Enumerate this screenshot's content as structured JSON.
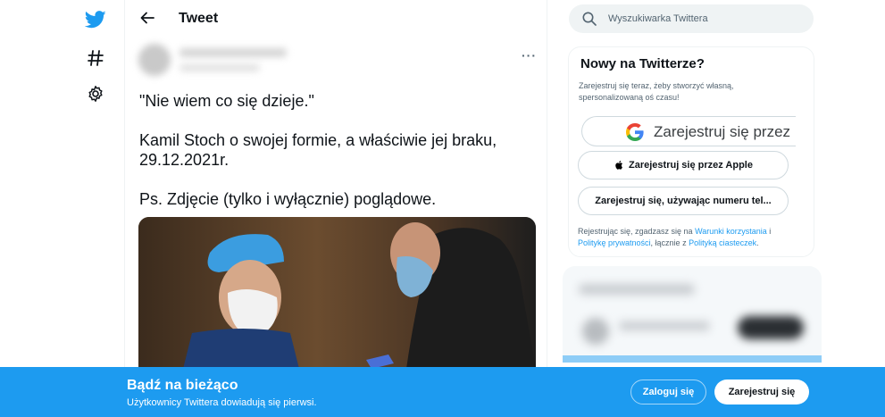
{
  "nav": {
    "items": [
      {
        "icon": "twitter-bird-icon",
        "color": "#1d9bf0"
      },
      {
        "icon": "hashtag-icon"
      },
      {
        "icon": "gear-icon"
      }
    ]
  },
  "header": {
    "title": "Tweet",
    "back_icon": "arrow-left-icon"
  },
  "tweet": {
    "more_label": "···",
    "lines": [
      "\"Nie wiem co się dzieje.\"",
      "Kamil Stoch o swojej formie, a właściwie jej braku, 29.12.2021r.",
      "Ps. Zdjęcie (tylko i wyłącznie) poglądowe."
    ]
  },
  "search": {
    "placeholder": "Wyszukiwarka Twittera"
  },
  "signup_panel": {
    "title": "Nowy na Twitterze?",
    "subtitle": "Zarejestruj się teraz, żeby stworzyć własną, spersonalizowaną oś czasu!",
    "google_label": "Zarejestruj się przez",
    "apple_label": "Zarejestruj się przez Apple",
    "phone_label": "Zarejestruj się, używając numeru tel...",
    "terms_prefix": "Rejestrując się, zgadzasz się na ",
    "terms_link": "Warunki korzystania",
    "terms_and": " i ",
    "privacy_link": "Politykę prywatności",
    "terms_mid": ", łącznie z ",
    "cookies_link": "Polityką ciasteczek",
    "terms_end": "."
  },
  "banner": {
    "heading": "Bądź na bieżąco",
    "subtext": "Użytkownicy Twittera dowiadują się pierwsi.",
    "login_label": "Zaloguj się",
    "signup_label": "Zarejestruj się",
    "background": "#1d9bf0"
  }
}
